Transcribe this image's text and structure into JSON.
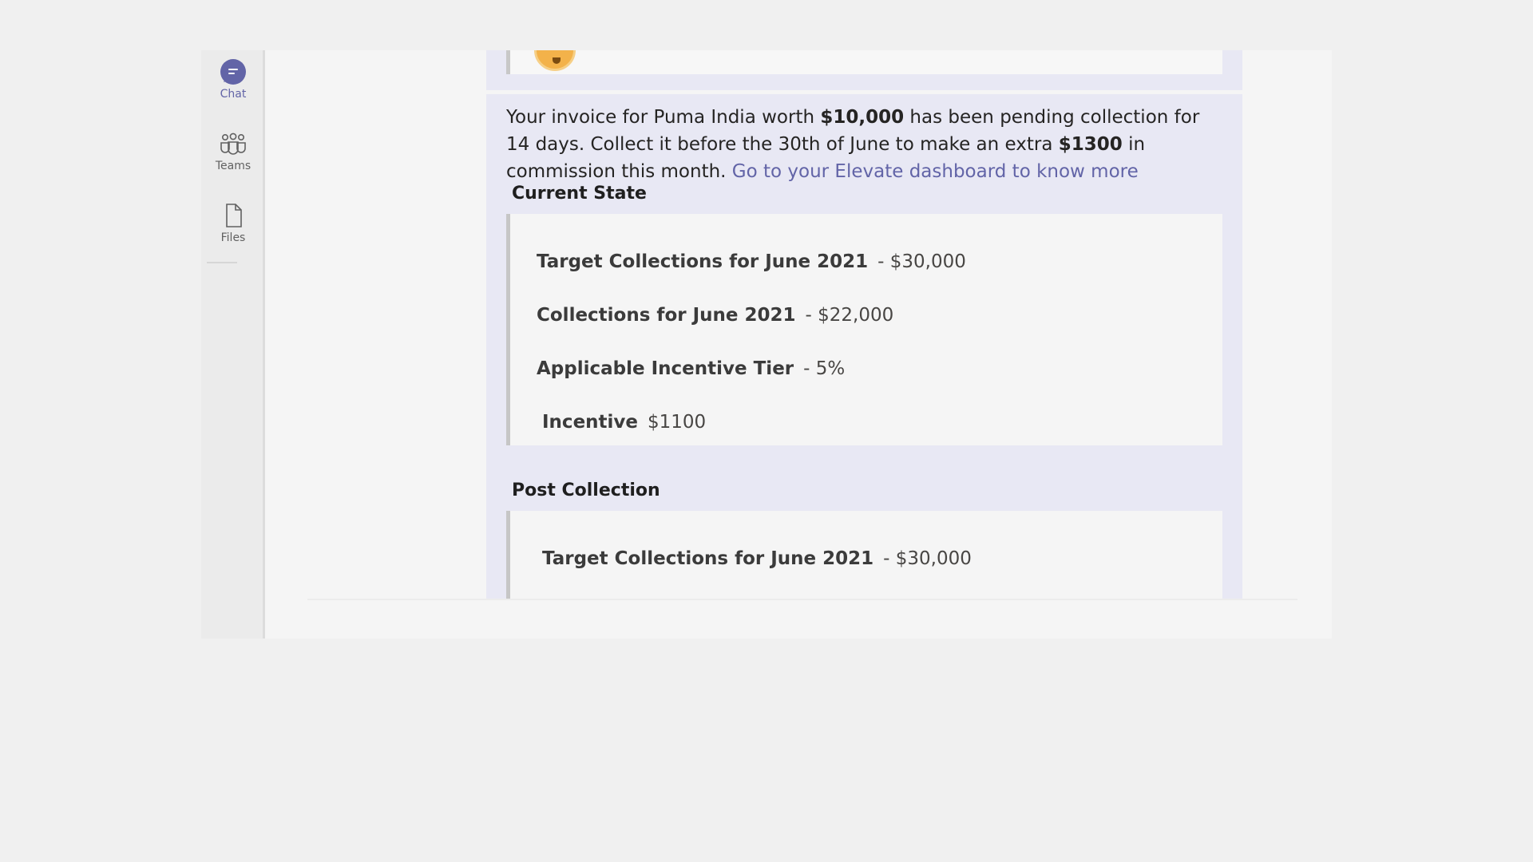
{
  "rail": {
    "items": [
      {
        "label": "Chat",
        "icon": "chat-icon",
        "active": true
      },
      {
        "label": "Teams",
        "icon": "teams-icon",
        "active": false
      },
      {
        "label": "Files",
        "icon": "files-icon",
        "active": false
      }
    ]
  },
  "message": {
    "text_part1": "Your invoice for Puma India worth ",
    "amount": "$10,000",
    "text_part2": " has been pending collection for 14 days. Collect it before the 30th of June to make an extra ",
    "commission": "$1300",
    "text_part3": " in commission this month. ",
    "link_text": "Go to your Elevate dashboard to know more"
  },
  "current_state": {
    "title": "Current State",
    "facts": [
      {
        "key": "Target Collections for June 2021",
        "value": "- $30,000"
      },
      {
        "key": "Collections for June 2021",
        "value": "- $22,000"
      },
      {
        "key": "Applicable Incentive Tier",
        "value": "- 5%"
      },
      {
        "key": "Incentive",
        "value": "$1100"
      }
    ]
  },
  "post_collection": {
    "title": "Post Collection",
    "facts": [
      {
        "key": "Target Collections for June 2021",
        "value": "- $30,000"
      }
    ]
  },
  "colors": {
    "accent": "#6264a7",
    "card_background": "#e8e8f4",
    "fact_background": "#f5f5f5"
  }
}
